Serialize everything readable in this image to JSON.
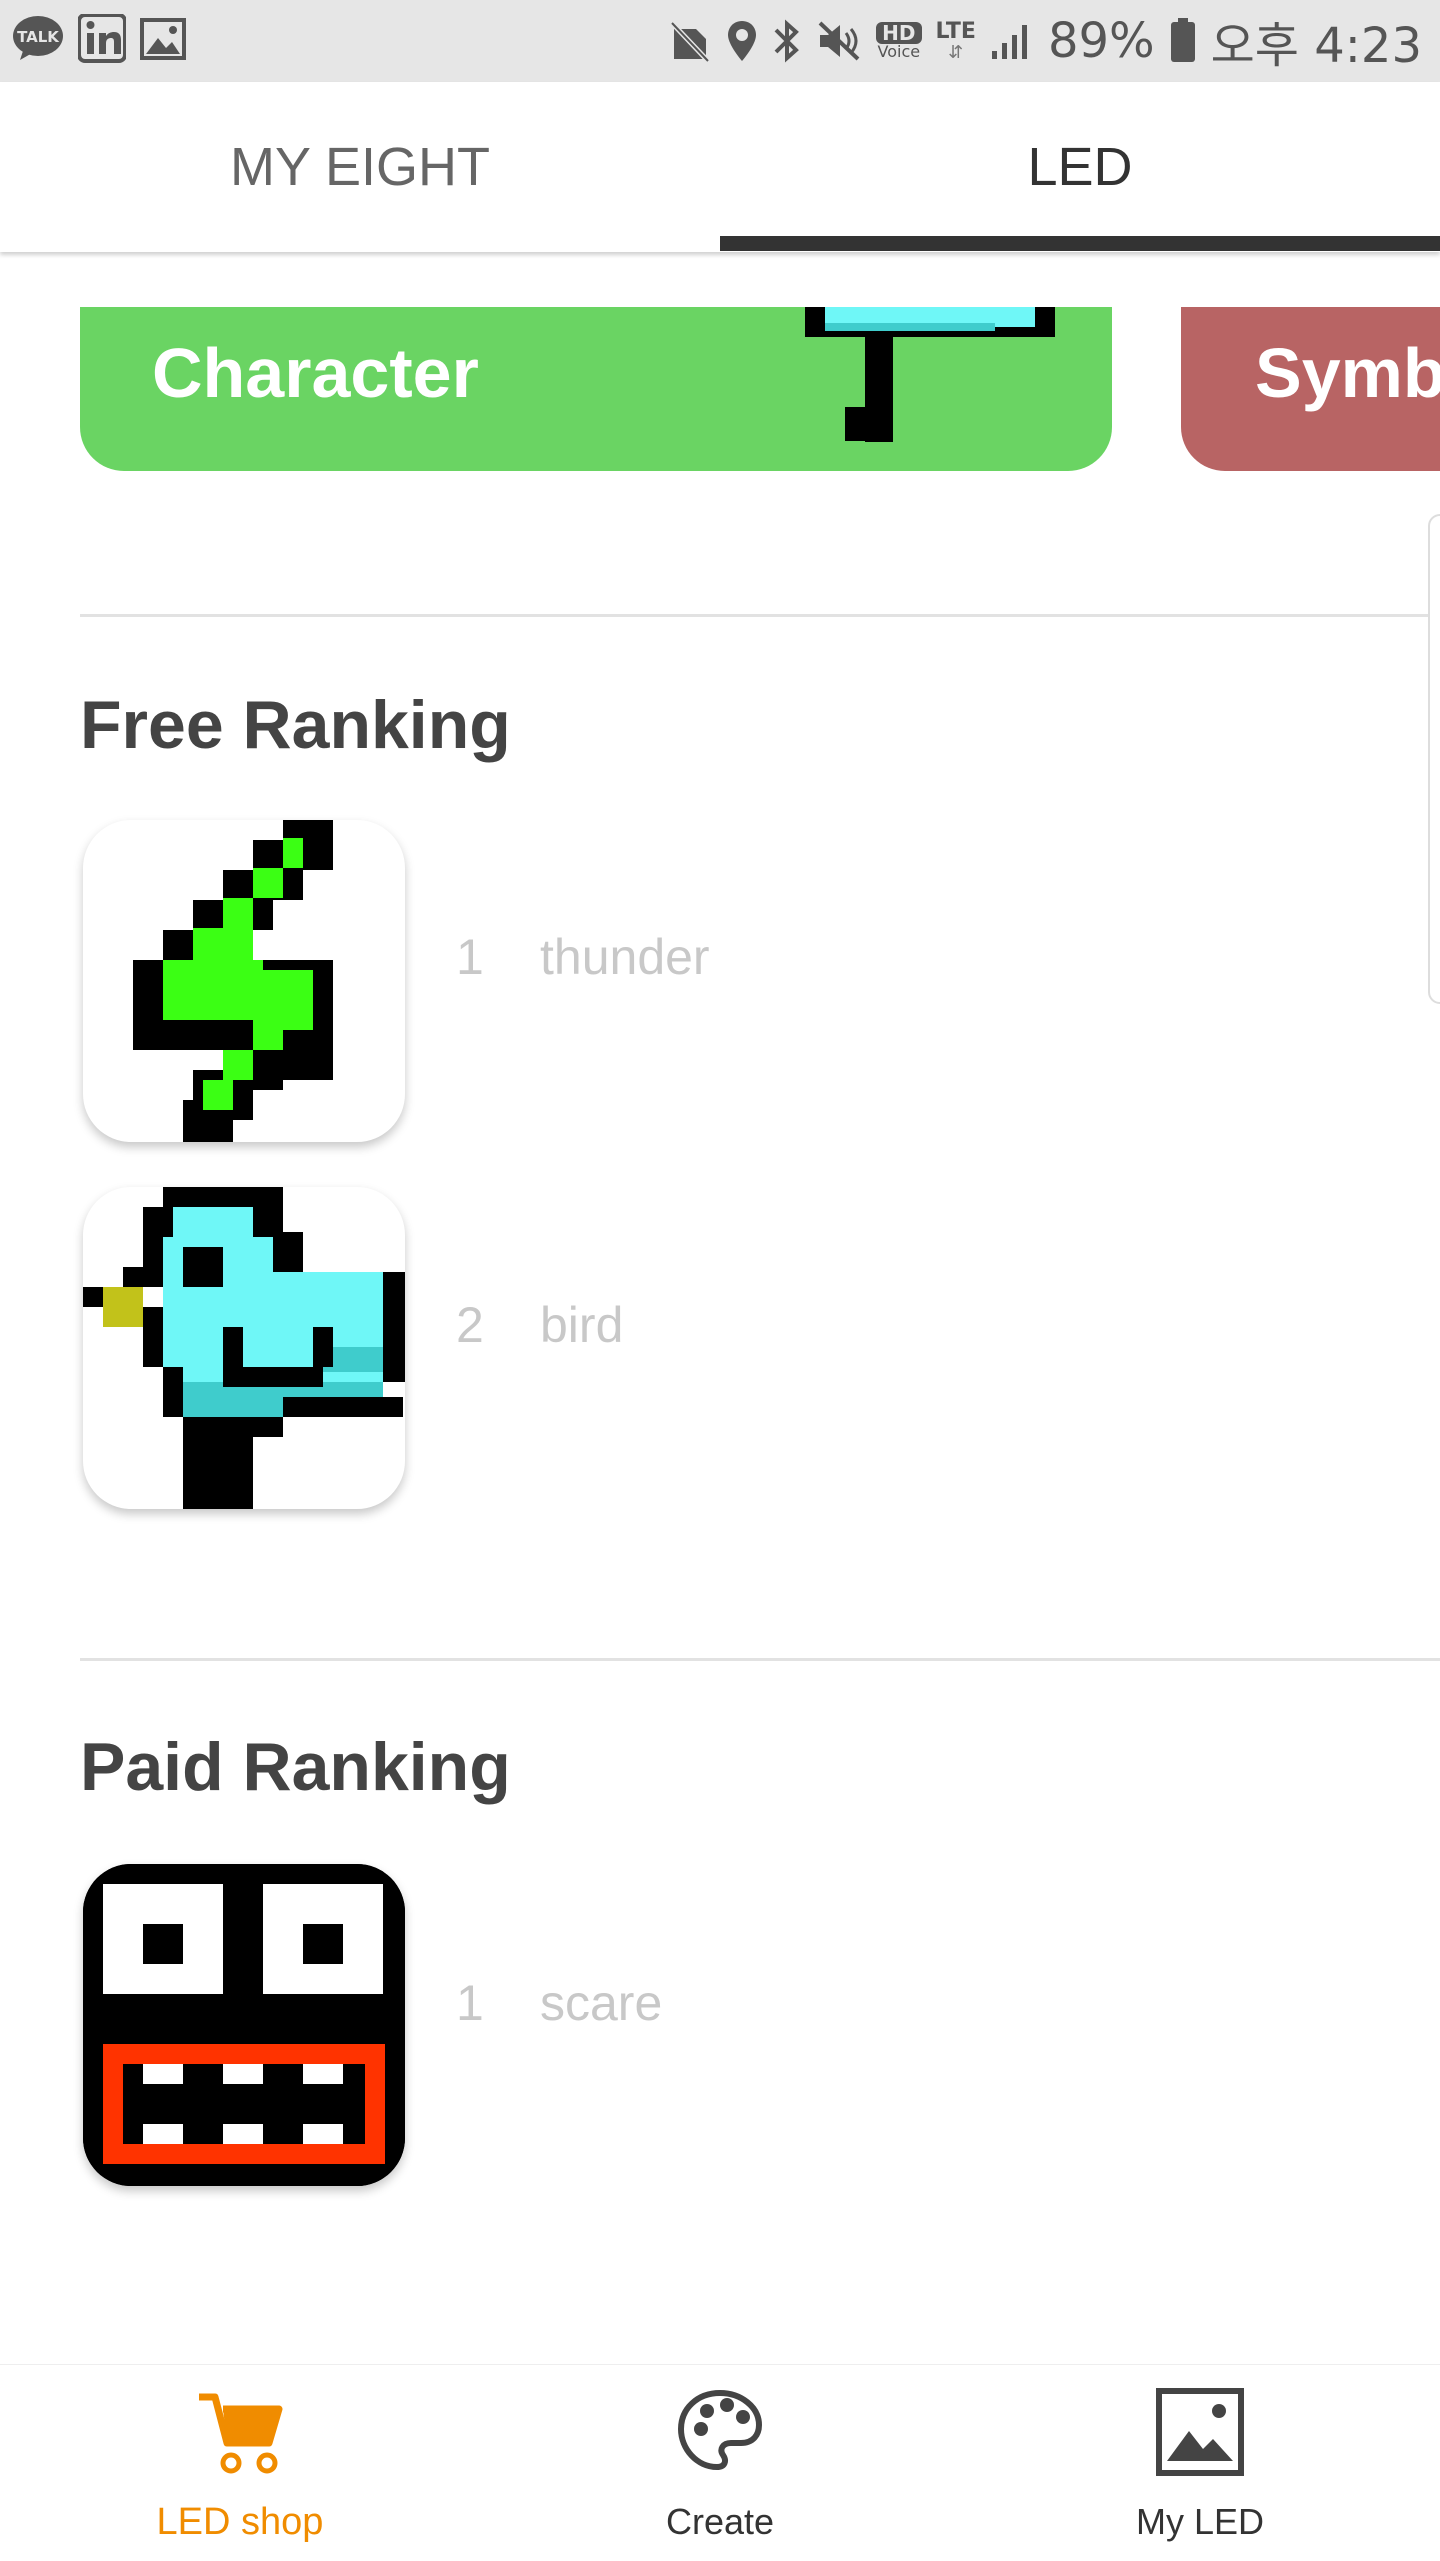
{
  "status_bar": {
    "battery": "89%",
    "time": "오후 4:23",
    "network": "LTE",
    "hd_label": "HD",
    "voice_label": "Voice",
    "left_icons": [
      "talk-icon",
      "linkedin-icon",
      "image-icon"
    ],
    "right_icons": [
      "no-sim-icon",
      "location-icon",
      "bluetooth-icon",
      "mute-icon",
      "hd-voice-icon",
      "lte-icon",
      "signal-icon",
      "battery-icon"
    ]
  },
  "tabs": [
    {
      "label": "MY EIGHT",
      "active": false
    },
    {
      "label": "LED",
      "active": true
    }
  ],
  "categories": [
    {
      "label": "Character",
      "color": "#6ad463"
    },
    {
      "label": "Symb",
      "color": "#b86464"
    }
  ],
  "free_ranking": {
    "title": "Free Ranking",
    "items": [
      {
        "rank": "1",
        "name": "thunder",
        "icon": "thunder-pixel-icon"
      },
      {
        "rank": "2",
        "name": "bird",
        "icon": "bird-pixel-icon"
      }
    ]
  },
  "paid_ranking": {
    "title": "Paid Ranking",
    "items": [
      {
        "rank": "1",
        "name": "scare",
        "icon": "scare-pixel-icon"
      }
    ]
  },
  "bottom_nav": [
    {
      "label": "LED shop",
      "icon": "cart-icon",
      "active": true,
      "color": "#f08c00"
    },
    {
      "label": "Create",
      "icon": "palette-icon",
      "active": false
    },
    {
      "label": "My LED",
      "icon": "picture-icon",
      "active": false
    }
  ]
}
